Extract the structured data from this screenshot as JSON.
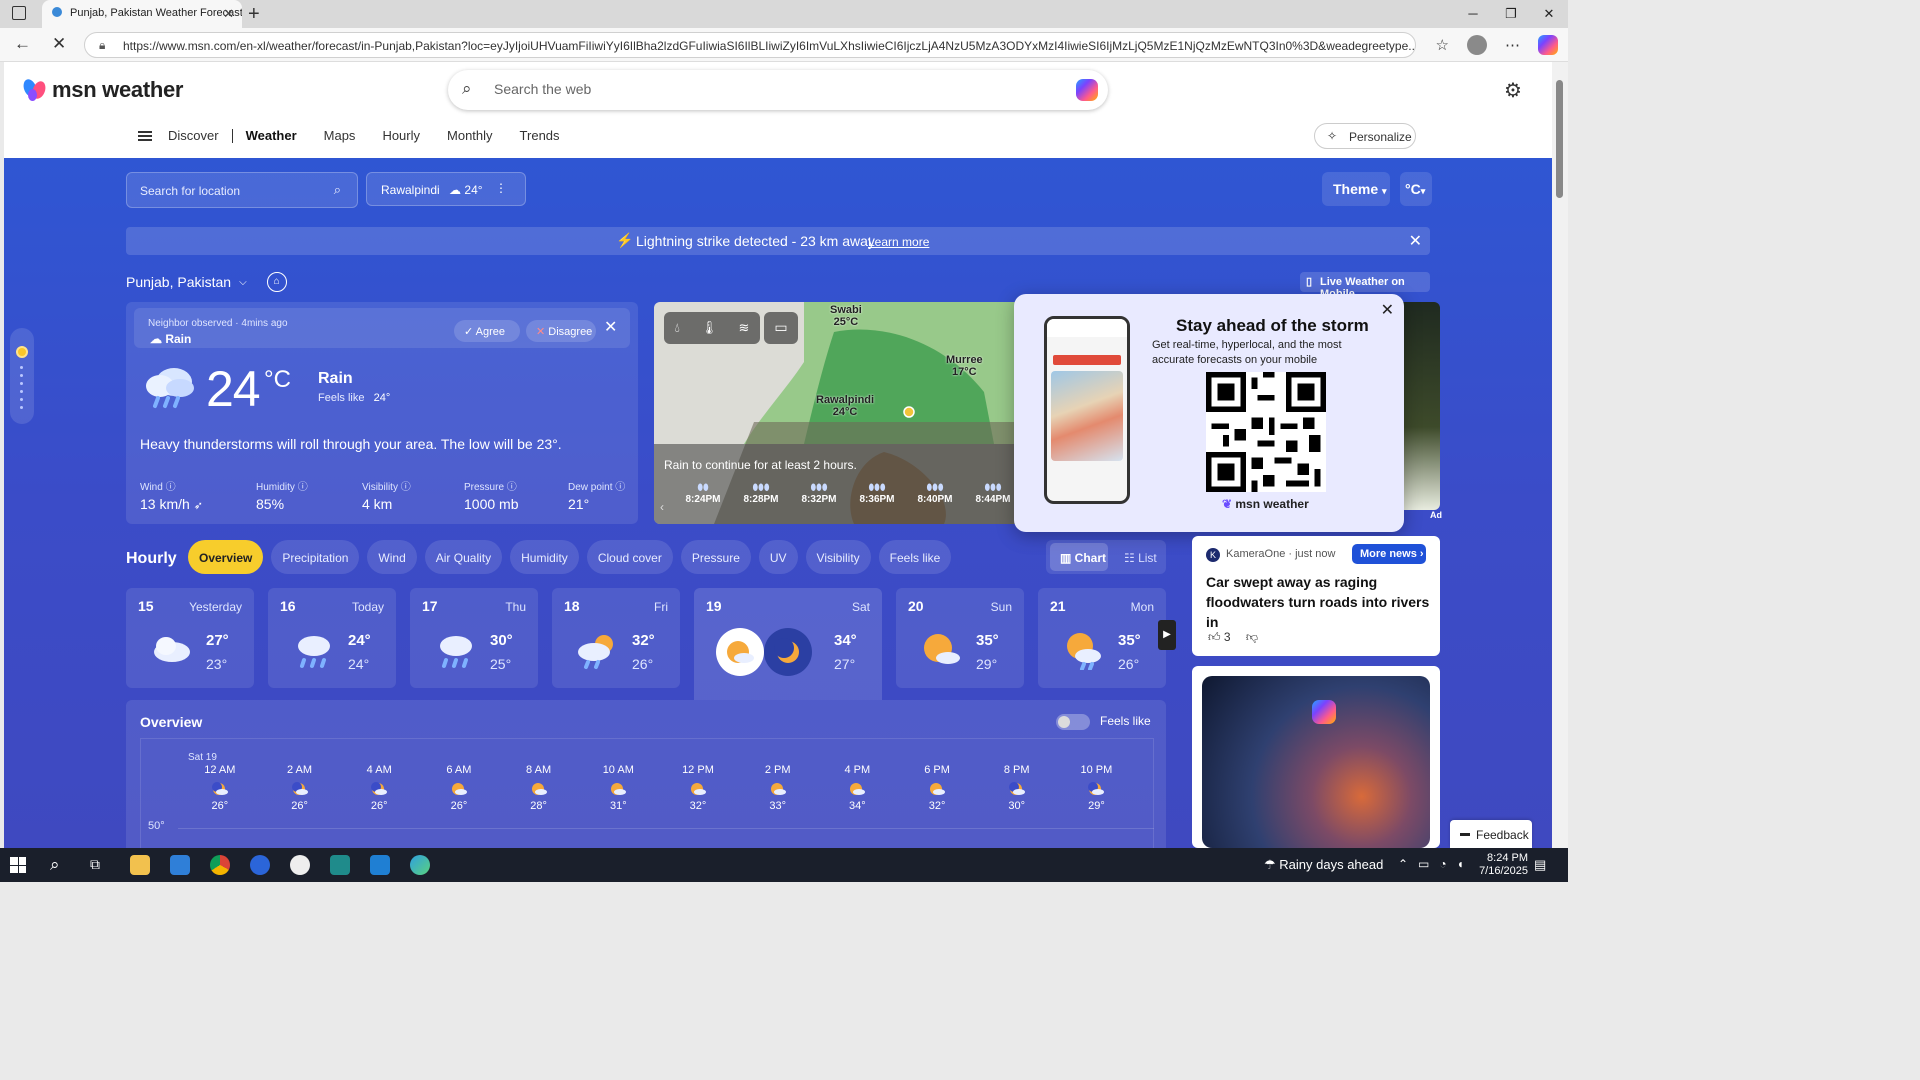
{
  "browser": {
    "tab_title": "Punjab, Pakistan Weather Forecast",
    "url": "https://www.msn.com/en-xl/weather/forecast/in-Punjab,Pakistan?loc=eyJyIjoiUHVuamFiIiwiYyI6IlBha2lzdGFuIiwiaSI6IlBLIiwiZyI6ImVuLXhsIiwieCI6IjczLjA4NzU5MzA3ODYxMzI4IiwieSI6IjMzLjQ5MzE1NjQzMzEwNTQ3In0%3D&weadegreetype..."
  },
  "header": {
    "logo_text": "msn weather",
    "search_placeholder": "Search the web",
    "nav": [
      "Discover",
      "Weather",
      "Maps",
      "Hourly",
      "Monthly",
      "Trends"
    ],
    "personalize": "Personalize"
  },
  "controls": {
    "location_search_placeholder": "Search for location",
    "saved_location": "Rawalpindi",
    "saved_temp": "24°",
    "theme": "Theme",
    "unit": "°C"
  },
  "alert": {
    "text": "Lightning strike detected - 23 km away",
    "link": "Learn more"
  },
  "region": {
    "name": "Punjab, Pakistan",
    "mobile_link": "Live Weather on Mobile"
  },
  "current": {
    "neighbor_observed": "Neighbor observed · 4mins ago",
    "neighbor_condition": "Rain",
    "agree": "Agree",
    "disagree": "Disagree",
    "temp": "24",
    "unit": "°C",
    "condition": "Rain",
    "feels_like_label": "Feels like",
    "feels_like": "24°",
    "summary": "Heavy thunderstorms will roll through your area. The low will be 23°.",
    "stats": [
      {
        "label": "Wind",
        "value": "13 km/h"
      },
      {
        "label": "Humidity",
        "value": "85%"
      },
      {
        "label": "Visibility",
        "value": "4 km"
      },
      {
        "label": "Pressure",
        "value": "1000 mb"
      },
      {
        "label": "Dew point",
        "value": "21°"
      }
    ]
  },
  "map": {
    "cities": [
      {
        "name": "Swabi",
        "temp": "25°C"
      },
      {
        "name": "Murree",
        "temp": "17°C"
      },
      {
        "name": "Rawalpindi",
        "temp": "24°C"
      }
    ],
    "message": "Rain to continue for at least 2 hours.",
    "times": [
      "8:24PM",
      "8:28PM",
      "8:32PM",
      "8:36PM",
      "8:40PM",
      "8:44PM"
    ]
  },
  "popup": {
    "title": "Stay ahead of the storm",
    "description": "Get real-time, hyperlocal, and the most accurate forecasts on your mobile",
    "brand": "msn weather"
  },
  "ad_label": "Ad",
  "hourly": {
    "title": "Hourly",
    "tabs": [
      "Overview",
      "Precipitation",
      "Wind",
      "Air Quality",
      "Humidity",
      "Cloud cover",
      "Pressure",
      "UV",
      "Visibility",
      "Feels like"
    ],
    "chart": "Chart",
    "list": "List"
  },
  "days": [
    {
      "num": "15",
      "name": "Yesterday",
      "hi": "27°",
      "lo": "23°",
      "icon": "cloudy-icon"
    },
    {
      "num": "16",
      "name": "Today",
      "hi": "24°",
      "lo": "24°",
      "icon": "rain-icon"
    },
    {
      "num": "17",
      "name": "Thu",
      "hi": "30°",
      "lo": "25°",
      "icon": "rain-icon"
    },
    {
      "num": "18",
      "name": "Fri",
      "hi": "32°",
      "lo": "26°",
      "icon": "partly-cloudy-rain-icon"
    },
    {
      "num": "19",
      "name": "Sat",
      "hi": "34°",
      "lo": "27°",
      "icon": "partly-sunny-icon"
    },
    {
      "num": "20",
      "name": "Sun",
      "hi": "35°",
      "lo": "29°",
      "icon": "partly-sunny-icon"
    },
    {
      "num": "21",
      "name": "Mon",
      "hi": "35°",
      "lo": "26°",
      "icon": "partly-sunny-rain-icon"
    }
  ],
  "overview": {
    "title": "Overview",
    "feels_like": "Feels like",
    "day_label": "Sat 19",
    "y_tick": "50°",
    "hours": [
      {
        "t": "12 AM",
        "v": "26°"
      },
      {
        "t": "2 AM",
        "v": "26°"
      },
      {
        "t": "4 AM",
        "v": "26°"
      },
      {
        "t": "6 AM",
        "v": "26°"
      },
      {
        "t": "8 AM",
        "v": "28°"
      },
      {
        "t": "10 AM",
        "v": "31°"
      },
      {
        "t": "12 PM",
        "v": "32°"
      },
      {
        "t": "2 PM",
        "v": "33°"
      },
      {
        "t": "4 PM",
        "v": "34°"
      },
      {
        "t": "6 PM",
        "v": "32°"
      },
      {
        "t": "8 PM",
        "v": "30°"
      },
      {
        "t": "10 PM",
        "v": "29°"
      }
    ]
  },
  "news": {
    "source": "KameraOne · just now",
    "more": "More news",
    "headline": "Car swept away as raging floodwaters turn roads into rivers in",
    "likes": "3"
  },
  "feedback": "Feedback",
  "taskbar": {
    "weather": "Rainy days ahead",
    "time": "8:24 PM",
    "date": "7/16/2025"
  },
  "colors": {
    "accent_yellow": "#f7cd2c",
    "bg_blue": "#2f56d3",
    "more_news_blue": "#1f51d8"
  }
}
